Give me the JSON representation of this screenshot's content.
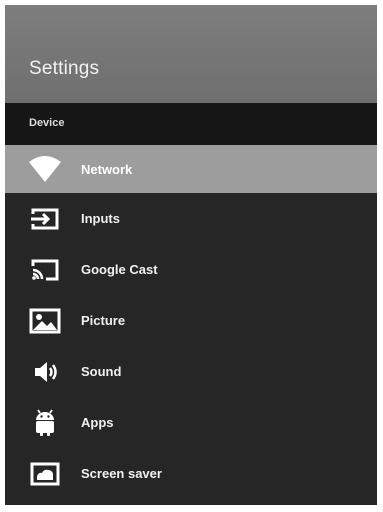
{
  "header": {
    "title": "Settings"
  },
  "section": {
    "label": "Device"
  },
  "menu": {
    "items": [
      {
        "label": "Network",
        "icon": "wifi-icon",
        "selected": true
      },
      {
        "label": "Inputs",
        "icon": "input-icon",
        "selected": false
      },
      {
        "label": "Google Cast",
        "icon": "cast-icon",
        "selected": false
      },
      {
        "label": "Picture",
        "icon": "picture-icon",
        "selected": false
      },
      {
        "label": "Sound",
        "icon": "speaker-icon",
        "selected": false
      },
      {
        "label": "Apps",
        "icon": "android-icon",
        "selected": false
      },
      {
        "label": "Screen saver",
        "icon": "screen-saver-icon",
        "selected": false
      }
    ]
  },
  "colors": {
    "header_background": "#7e7e7e",
    "section_background": "#161616",
    "list_background": "#262626",
    "selected_background": "#9d9d9d",
    "text": "#f0f0f0"
  }
}
